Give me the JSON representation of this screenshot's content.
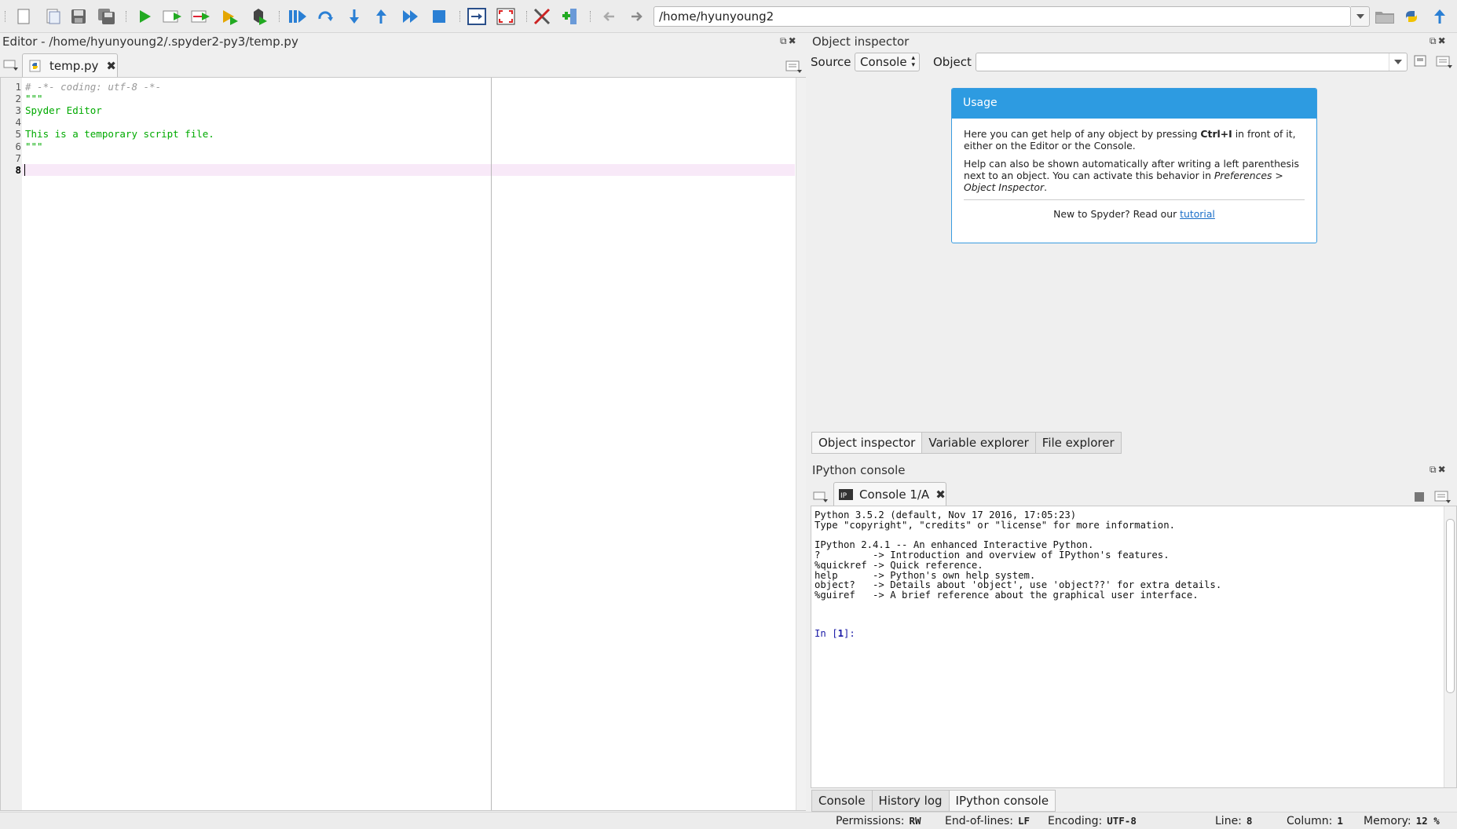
{
  "toolbar": {
    "path": "/home/hyunyoung2",
    "icons": [
      "new-file-icon",
      "open-file-icon",
      "save-icon",
      "save-all-icon",
      "run-icon",
      "run-cell-icon",
      "run-cell-advance-icon",
      "run-selection-icon",
      "debug-icon",
      "debug-start-icon",
      "step-icon",
      "step-into-icon",
      "step-return-icon",
      "continue-icon",
      "stop-icon",
      "maximize-pane-icon",
      "fullscreen-icon",
      "preferences-icon",
      "pythonpath-icon",
      "back-icon",
      "forward-icon",
      "browse-folder-icon",
      "python-icon",
      "parent-dir-icon"
    ]
  },
  "editor": {
    "title": "Editor - /home/hyunyoung2/.spyder2-py3/temp.py",
    "tab_label": "temp.py",
    "line_numbers": [
      "1",
      "2",
      "3",
      "4",
      "5",
      "6",
      "7",
      "8"
    ],
    "lines": [
      {
        "text": "# -*- coding: utf-8 -*-",
        "color": "#999999",
        "italic": true
      },
      {
        "text": "\"\"\"",
        "color": "#00aa00"
      },
      {
        "text": "Spyder Editor",
        "color": "#00aa00"
      },
      {
        "text": "",
        "color": "#000000"
      },
      {
        "text": "This is a temporary script file.",
        "color": "#00aa00"
      },
      {
        "text": "\"\"\"",
        "color": "#00aa00"
      },
      {
        "text": "",
        "color": "#000000"
      },
      {
        "text": "",
        "color": "#000000"
      }
    ]
  },
  "object_inspector": {
    "title": "Object inspector",
    "source_label": "Source",
    "source_value": "Console",
    "object_label": "Object",
    "object_value": "",
    "usage": {
      "heading": "Usage",
      "p1_before": "Here you can get help of any object by pressing ",
      "p1_key": "Ctrl+I",
      "p1_after": " in front of it, either on the Editor or the Console.",
      "p2_before": "Help can also be shown automatically after writing a left parenthesis next to an object. You can activate this behavior in ",
      "p2_em": "Preferences > Object Inspector",
      "p2_after": ".",
      "footer_text": "New to Spyder? Read our ",
      "footer_link": "tutorial"
    },
    "tabs": [
      "Object inspector",
      "Variable explorer",
      "File explorer"
    ]
  },
  "ipython": {
    "title": "IPython console",
    "tab_label": "Console 1/A",
    "lines": [
      "Python 3.5.2 (default, Nov 17 2016, 17:05:23)",
      "Type \"copyright\", \"credits\" or \"license\" for more information.",
      "",
      "IPython 2.4.1 -- An enhanced Interactive Python.",
      "?         -> Introduction and overview of IPython's features.",
      "%quickref -> Quick reference.",
      "help      -> Python's own help system.",
      "object?   -> Details about 'object', use 'object??' for extra details.",
      "%guiref   -> A brief reference about the graphical user interface."
    ],
    "prompt_prefix": "In [",
    "prompt_num": "1",
    "prompt_suffix": "]:",
    "tabs": [
      "Console",
      "History log",
      "IPython console"
    ]
  },
  "status": {
    "permissions_label": "Permissions:",
    "permissions_value": "RW",
    "eol_label": "End-of-lines:",
    "eol_value": "LF",
    "encoding_label": "Encoding:",
    "encoding_value": "UTF-8",
    "line_label": "Line:",
    "line_value": "8",
    "column_label": "Column:",
    "column_value": "1",
    "memory_label": "Memory:",
    "memory_value": "12 %"
  },
  "colors": {
    "accent": "#2d9be1",
    "run_green": "#22aa22",
    "debug_blue": "#2a7fd4",
    "current_line": "#f8e9f8"
  }
}
